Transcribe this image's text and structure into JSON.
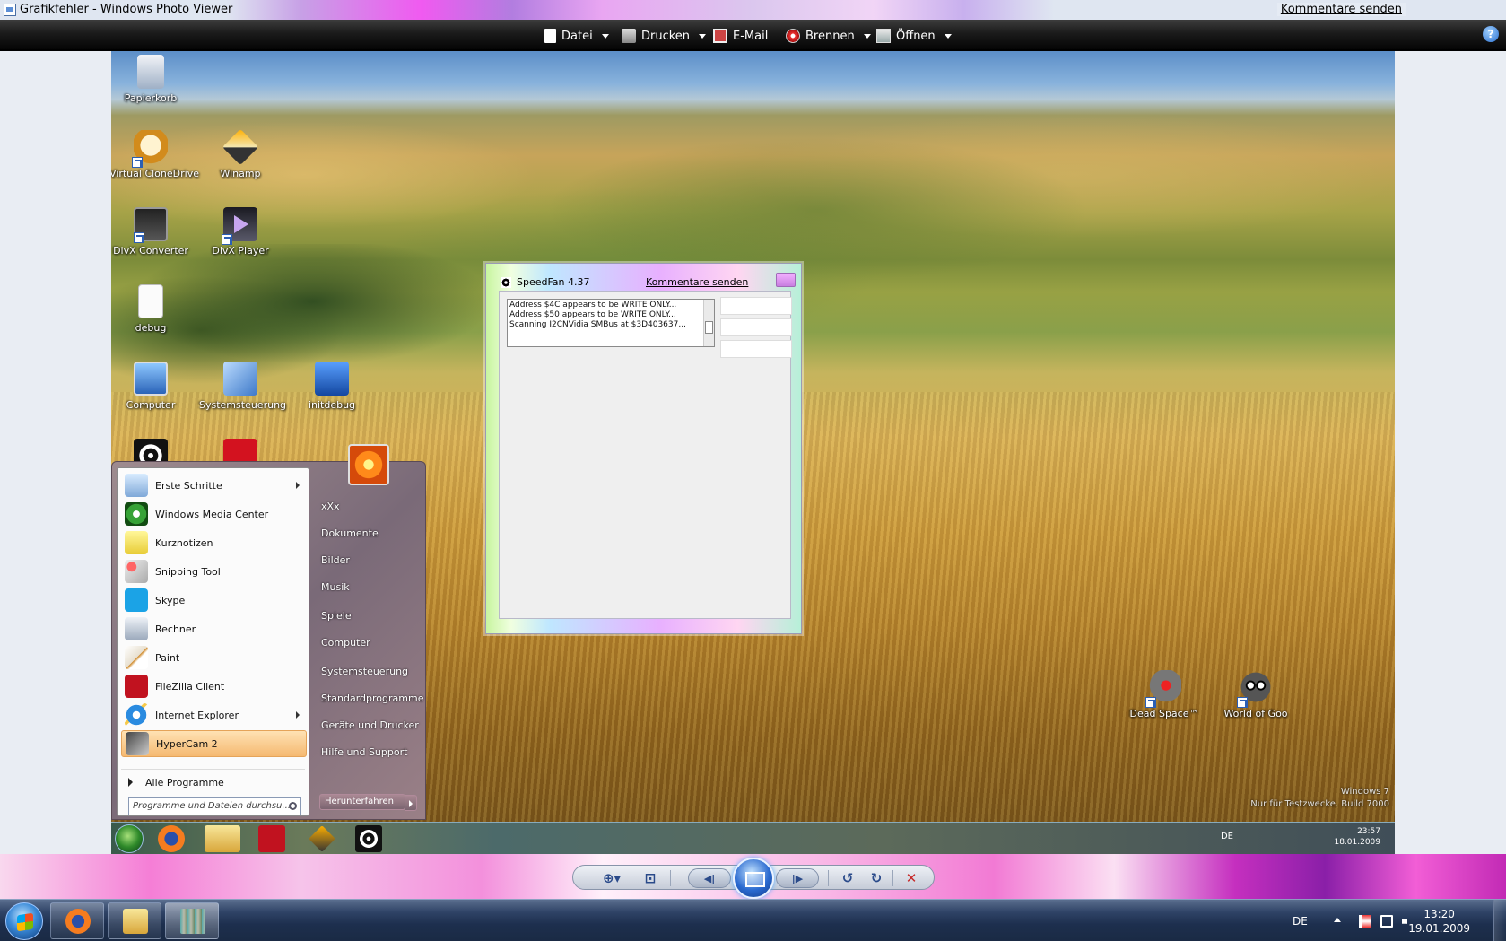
{
  "window": {
    "title": "Grafikfehler - Windows Photo Viewer",
    "feedback_link": "Kommentare senden"
  },
  "toolbar": {
    "file": "Datei",
    "print": "Drucken",
    "email": "E-Mail",
    "burn": "Brennen",
    "open": "Öffnen",
    "help": "?"
  },
  "screenshot": {
    "desktop_icons": [
      {
        "label": "Papierkorb",
        "icon": "recycle-bin-icon"
      },
      {
        "label": "Virtual CloneDrive",
        "icon": "clonedrive-icon"
      },
      {
        "label": "Winamp",
        "icon": "winamp-icon"
      },
      {
        "label": "DivX Converter",
        "icon": "divx-converter-icon"
      },
      {
        "label": "DivX Player",
        "icon": "divx-player-icon"
      },
      {
        "label": "debug",
        "icon": "document-icon"
      },
      {
        "label": "Computer",
        "icon": "computer-icon"
      },
      {
        "label": "Systemsteuerung",
        "icon": "control-panel-icon"
      },
      {
        "label": "initdebug",
        "icon": "info-icon"
      },
      {
        "label": "Dead Space™",
        "icon": "dead-space-icon"
      },
      {
        "label": "World of Goo",
        "icon": "world-of-goo-icon"
      }
    ],
    "speedfan": {
      "title": "SpeedFan 4.37",
      "feedback_link": "Kommentare senden",
      "log_lines": [
        "Address $4C appears to be WRITE ONLY...",
        "Address $50 appears to be WRITE ONLY...",
        "Scanning I2CNVidia SMBus at $3D403637..."
      ]
    },
    "start_menu": {
      "items": [
        {
          "label": "Erste Schritte",
          "icon": "first-steps-icon",
          "submenu": true
        },
        {
          "label": "Windows Media Center",
          "icon": "media-center-icon",
          "submenu": false
        },
        {
          "label": "Kurznotizen",
          "icon": "sticky-notes-icon",
          "submenu": false
        },
        {
          "label": "Snipping Tool",
          "icon": "snipping-tool-icon",
          "submenu": false
        },
        {
          "label": "Skype",
          "icon": "skype-icon",
          "submenu": false
        },
        {
          "label": "Rechner",
          "icon": "calculator-icon",
          "submenu": false
        },
        {
          "label": "Paint",
          "icon": "paint-icon",
          "submenu": false
        },
        {
          "label": "FileZilla Client",
          "icon": "filezilla-icon",
          "submenu": false
        },
        {
          "label": "Internet Explorer",
          "icon": "internet-explorer-icon",
          "submenu": true
        },
        {
          "label": "HyperCam 2",
          "icon": "hypercam-icon",
          "submenu": false,
          "active": true
        }
      ],
      "all_programs": "Alle Programme",
      "search_placeholder": "Programme und Dateien durchsu...",
      "right_links": [
        "xXx",
        "Dokumente",
        "Bilder",
        "Musik",
        "Spiele",
        "Computer",
        "Systemsteuerung",
        "Standardprogramme",
        "Geräte und Drucker",
        "Hilfe und Support"
      ],
      "shutdown": "Herunterfahren"
    },
    "watermark": {
      "line1": "Windows 7",
      "line2": "Nur für Testzwecke. Build 7000"
    },
    "inner_tray": {
      "lang": "DE",
      "time": "23:57",
      "date": "18.01.2009"
    }
  },
  "viewer_controls": {
    "zoom": "zoom-icon",
    "actual_size": "actual-size-icon",
    "previous": "previous-icon",
    "slideshow": "slideshow-icon",
    "next": "next-icon",
    "rotate_left": "rotate-counterclockwise-icon",
    "rotate_right": "rotate-clockwise-icon",
    "delete": "delete-icon"
  },
  "taskbar": {
    "lang": "DE",
    "time": "13:20",
    "date": "19.01.2009",
    "pinned": [
      "firefox-icon",
      "explorer-icon",
      "photo-viewer-icon"
    ]
  }
}
